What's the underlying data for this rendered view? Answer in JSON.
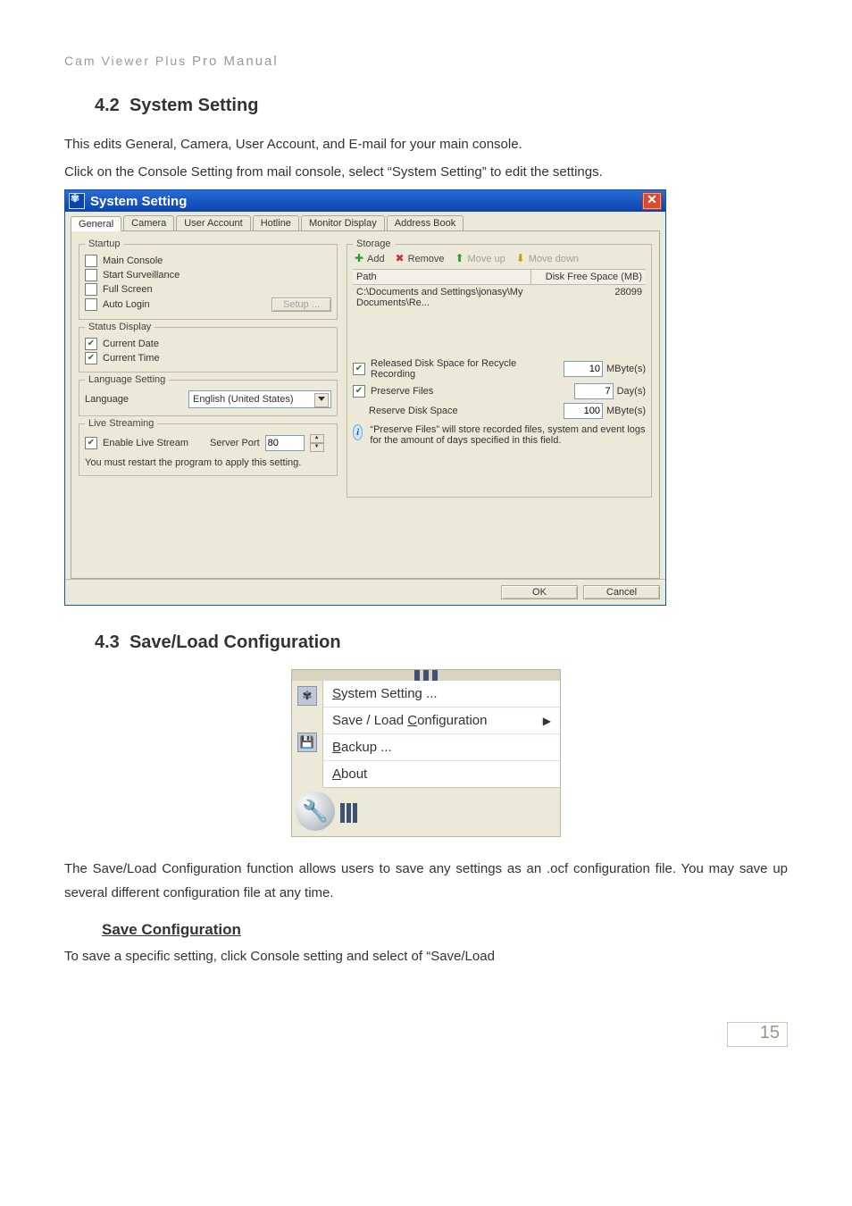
{
  "header": {
    "prefix": "Cam Viewer Plus",
    "suffix": "Pro Manual"
  },
  "sec42": {
    "num": "4.2",
    "title": "System Setting",
    "para1": "This edits General, Camera, User Account, and E-mail for your main console.",
    "para2": "Click on the Console Setting from mail console, select “System Setting” to edit the settings."
  },
  "win": {
    "title": "System Setting",
    "tabs": {
      "general": "General",
      "camera": "Camera",
      "user": "User Account",
      "hotline": "Hotline",
      "monitor": "Monitor Display",
      "address": "Address Book"
    },
    "startup": {
      "legend": "Startup",
      "main_console": "Main Console",
      "start_surv": "Start Surveillance",
      "full_screen": "Full Screen",
      "auto_login": "Auto Login",
      "setup_btn": "Setup ..."
    },
    "status": {
      "legend": "Status Display",
      "cur_date": "Current Date",
      "cur_time": "Current Time"
    },
    "lang": {
      "legend": "Language Setting",
      "label": "Language",
      "value": "English (United States)"
    },
    "live": {
      "legend": "Live Streaming",
      "enable": "Enable Live Stream",
      "port_label": "Server Port",
      "port_value": "80",
      "note": "You must restart the program to apply this setting."
    },
    "storage": {
      "legend": "Storage",
      "add": "Add",
      "remove": "Remove",
      "moveup": "Move up",
      "movedown": "Move down",
      "col_path": "Path",
      "col_free": "Disk Free Space (MB)",
      "row_path": "C:\\Documents and Settings\\jonasy\\My Documents\\Re...",
      "row_free": "28099",
      "released_lbl": "Released Disk Space for Recycle Recording",
      "released_val": "10",
      "released_unit": "MByte(s)",
      "preserve_lbl": "Preserve Files",
      "preserve_val": "7",
      "preserve_unit": "Day(s)",
      "reserve_lbl": "Reserve Disk Space",
      "reserve_val": "100",
      "reserve_unit": "MByte(s)",
      "info": "“Preserve Files” will store recorded files, system and event logs for the amount of days specified in this field."
    },
    "ok": "OK",
    "cancel": "Cancel"
  },
  "sec43": {
    "num": "4.3",
    "title": "Save/Load Configuration",
    "menu": {
      "system": "ystem Setting ...",
      "system_u": "S",
      "saveload": "Save / Load ",
      "saveload_u": "C",
      "saveload2": "onfiguration",
      "backup_u": "B",
      "backup": "ackup ...",
      "about_u": "A",
      "about": "bout"
    },
    "para1": "The Save/Load Configuration function allows users to save any settings as an .ocf configuration file. You may save up several different configuration file at any time.",
    "sub": "Save Configuration",
    "para2": "To save a specific setting, click Console setting and select of “Save/Load"
  },
  "page_num": "15"
}
